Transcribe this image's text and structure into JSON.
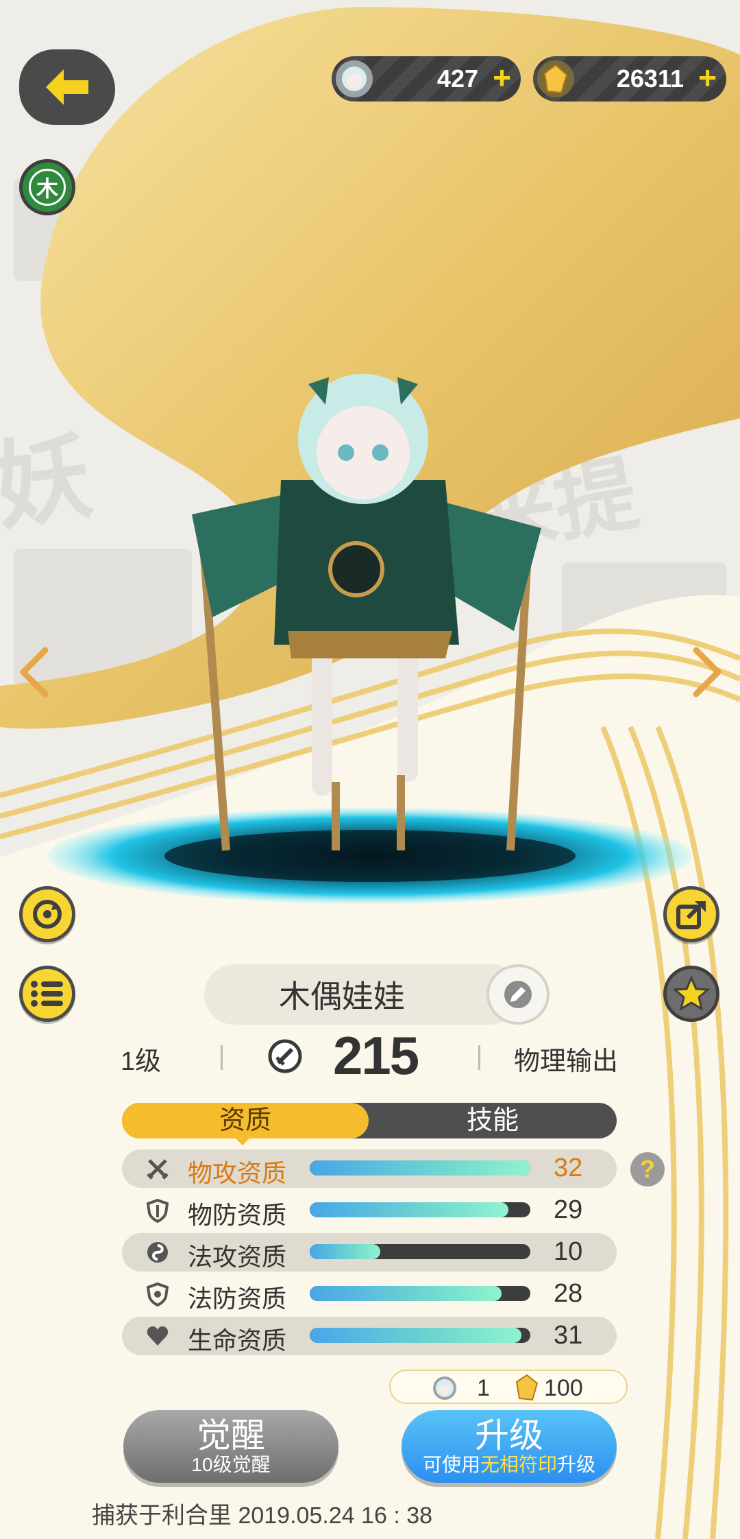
{
  "currencies": [
    {
      "icon": "spirit-head-icon",
      "value": "427",
      "plus": "+"
    },
    {
      "icon": "gold-crystal-icon",
      "value": "26311",
      "plus": "+"
    }
  ],
  "element": {
    "label": "木"
  },
  "pet": {
    "name": "木偶娃娃",
    "level": "1级",
    "power": "215",
    "role": "物理输出"
  },
  "tabs": {
    "quality": "资质",
    "skill": "技能",
    "active": "quality"
  },
  "attributes": [
    {
      "icon": "crossed-swords-icon",
      "label": "物攻资质",
      "value": "32",
      "fill": 1.0,
      "highlight": true
    },
    {
      "icon": "shield-icon",
      "label": "物防资质",
      "value": "29",
      "fill": 0.9,
      "highlight": false
    },
    {
      "icon": "swirl-icon",
      "label": "法攻资质",
      "value": "10",
      "fill": 0.32,
      "highlight": false
    },
    {
      "icon": "magic-shield-icon",
      "label": "法防资质",
      "value": "28",
      "fill": 0.87,
      "highlight": false
    },
    {
      "icon": "heart-icon",
      "label": "生命资质",
      "value": "31",
      "fill": 0.96,
      "highlight": false
    }
  ],
  "help": "?",
  "upgrade_cost": {
    "item1": "1",
    "item2": "100"
  },
  "buttons": {
    "awaken_main": "觉醒",
    "awaken_sub": "10级觉醒",
    "upgrade_main": "升级",
    "upgrade_sub_prefix": "可使用",
    "upgrade_sub_highlight": "无相符印",
    "upgrade_sub_suffix": "升级"
  },
  "caught_info": "捕获于利合里 2019.05.24 16 : 38",
  "colors": {
    "accent_yellow": "#f5bd2d",
    "bar_blue": "#48a6e8",
    "highlight_orange": "#d97a12",
    "upgrade_blue": "#2c8ff0"
  }
}
